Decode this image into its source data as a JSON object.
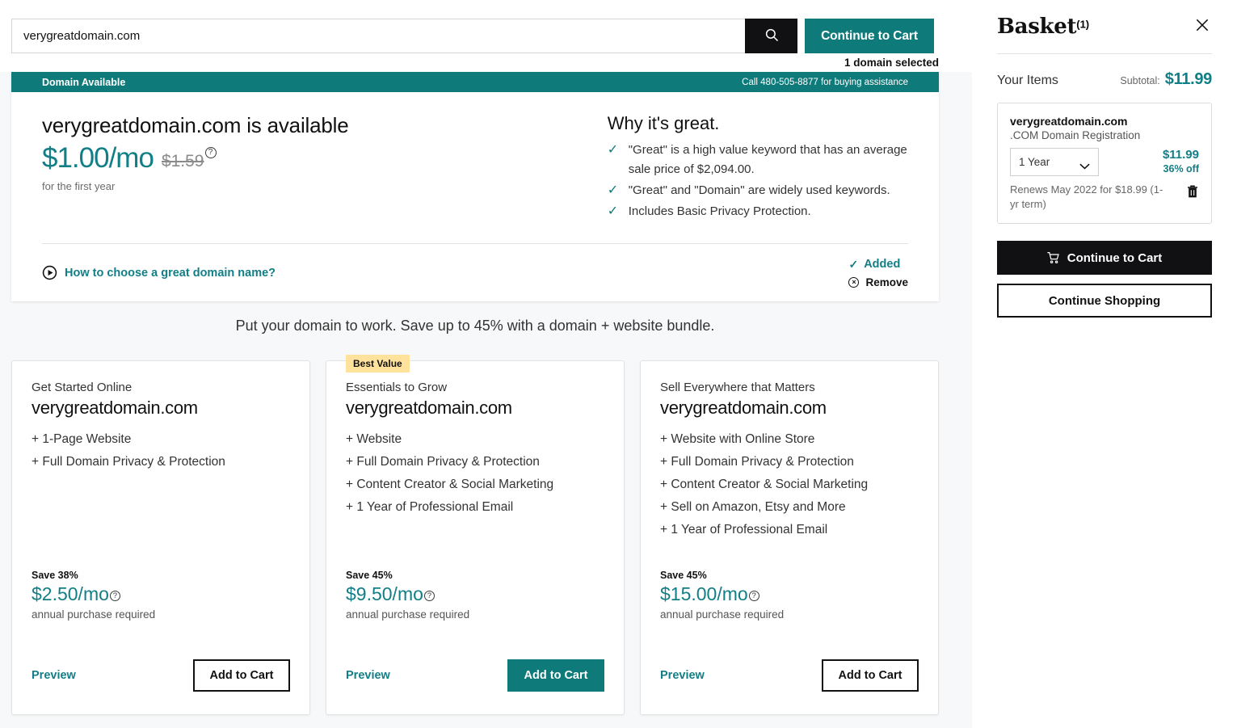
{
  "search": {
    "value": "verygreatdomain.com",
    "placeholder": "Search for a domain",
    "search_icon": "search-icon",
    "continue_label": "Continue to Cart",
    "selected_note": "1 domain selected"
  },
  "availability": {
    "banner_left": "Domain Available",
    "banner_right": "Call 480-505-8877 for buying assistance",
    "title": "verygreatdomain.com is available",
    "price": "$1.00/mo",
    "price_old": "$1.59",
    "tooltip_glyph": "?",
    "price_note": "for the first year",
    "why_title": "Why it's great.",
    "why_items": [
      "\"Great\" is a high value keyword that has an average sale price of $2,094.00.",
      "\"Great\" and \"Domain\" are widely used keywords.",
      "Includes Basic Privacy Protection."
    ],
    "check_glyph": "✓",
    "howto_label": "How to choose a great domain name?",
    "added_label": "Added",
    "remove_label": "Remove",
    "remove_glyph": "×"
  },
  "bundles": {
    "headline": "Put your domain to work. Save up to 45% with a domain + website bundle.",
    "best_value_badge": "Best Value",
    "cards": [
      {
        "kicker": "Get Started Online",
        "domain": "verygreatdomain.com",
        "features": [
          "+ 1-Page Website",
          "+ Full Domain Privacy & Protection"
        ],
        "save": "Save 38%",
        "price": "$2.50/mo",
        "note": "annual purchase required",
        "preview": "Preview",
        "add": "Add to Cart"
      },
      {
        "kicker": "Essentials to Grow",
        "domain": "verygreatdomain.com",
        "features": [
          "+ Website",
          "+ Full Domain Privacy & Protection",
          "+ Content Creator & Social Marketing",
          "+ 1 Year of Professional Email"
        ],
        "save": "Save 45%",
        "price": "$9.50/mo",
        "note": "annual purchase required",
        "preview": "Preview",
        "add": "Add to Cart"
      },
      {
        "kicker": "Sell Everywhere that Matters",
        "domain": "verygreatdomain.com",
        "features": [
          "+ Website with Online Store",
          "+ Full Domain Privacy & Protection",
          "+ Content Creator & Social Marketing",
          "+ Sell on Amazon, Etsy and More",
          "+ 1 Year of Professional Email"
        ],
        "save": "Save 45%",
        "price": "$15.00/mo",
        "note": "annual purchase required",
        "preview": "Preview",
        "add": "Add to Cart"
      }
    ]
  },
  "basket": {
    "title": "Basket",
    "count": "(1)",
    "close_icon": "close-icon",
    "your_items_label": "Your Items",
    "subtotal_label": "Subtotal:",
    "subtotal_value": "$11.99",
    "item": {
      "name": "verygreatdomain.com",
      "type": ".COM Domain Registration",
      "term": "1 Year",
      "price": "$11.99",
      "discount": "36% off",
      "renews": "Renews May 2022 for $18.99 (1-yr term)",
      "delete_icon": "trash-icon"
    },
    "continue_cart": "Continue to Cart",
    "continue_shopping": "Continue Shopping"
  },
  "colors": {
    "teal": "#0f7a7a",
    "teal_text": "#127e86",
    "black": "#111113",
    "badge_yellow": "#ffe39c"
  }
}
